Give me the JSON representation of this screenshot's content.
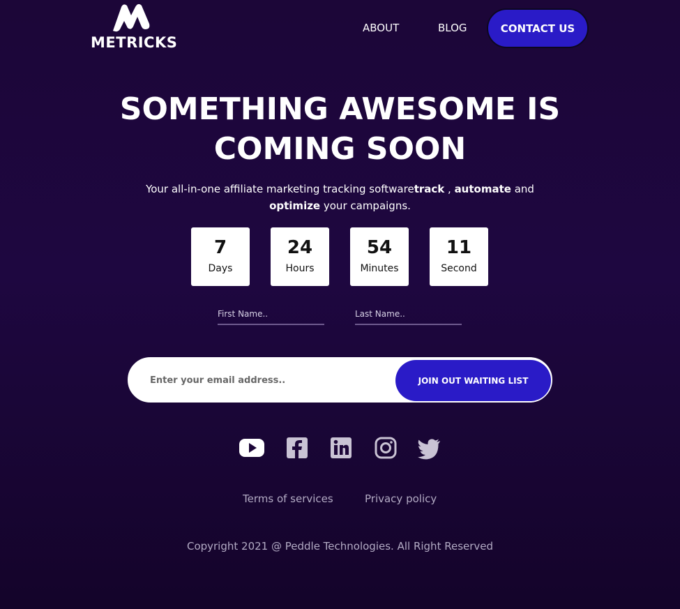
{
  "brand": {
    "name": "METRICKS"
  },
  "nav": {
    "about": "ABOUT",
    "blog": "BLOG",
    "contact": "CONTACT US"
  },
  "hero": {
    "line1": "SOMETHING AWESOME IS",
    "line2": "COMING SOON",
    "subtitle_part1": "Your all-in-one affiliate marketing tracking software",
    "subtitle_bold1": "track",
    "subtitle_part2": " , ",
    "subtitle_bold2": "automate",
    "subtitle_part3": " and ",
    "subtitle_bold3": "optimize",
    "subtitle_part4": " your campaigns."
  },
  "countdown": [
    {
      "value": "7",
      "label": "Days"
    },
    {
      "value": "24",
      "label": "Hours"
    },
    {
      "value": "54",
      "label": "Minutes"
    },
    {
      "value": "11",
      "label": "Second"
    }
  ],
  "form": {
    "first_name_placeholder": "First Name..",
    "last_name_placeholder": "Last Name..",
    "email_placeholder": "Enter your email address..",
    "join_label": "JOIN OUT WAITING LIST"
  },
  "social": [
    "youtube-icon",
    "facebook-icon",
    "linkedin-icon",
    "instagram-icon",
    "twitter-icon"
  ],
  "footer": {
    "terms": "Terms of services",
    "privacy": "Privacy policy",
    "copyright": "Copyright 2021 @ Peddle Technologies. All Right Reserved"
  },
  "colors": {
    "accent": "#2a1bc7",
    "background": "#1c0638"
  }
}
